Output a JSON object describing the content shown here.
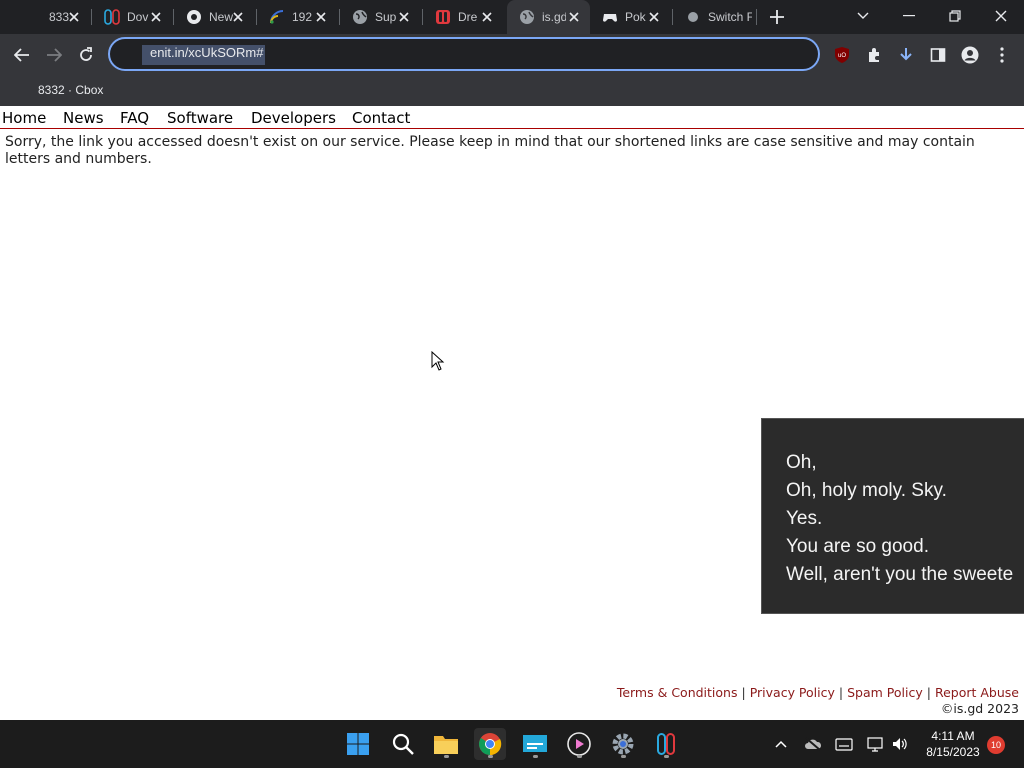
{
  "browser": {
    "tabs": [
      {
        "title": "833",
        "icon": "page-icon"
      },
      {
        "title": "Dov",
        "icon": "switch-logo-icon"
      },
      {
        "title": "New",
        "icon": "chrome-icon"
      },
      {
        "title": "192",
        "icon": "rss-icon"
      },
      {
        "title": "Sup",
        "icon": "globe-icon"
      },
      {
        "title": "Dre",
        "icon": "switch-red-icon"
      },
      {
        "title": "is.gd",
        "icon": "globe-icon"
      },
      {
        "title": "Pok",
        "icon": "gamepad-icon"
      },
      {
        "title": "Switch F",
        "icon": "globe-icon"
      }
    ],
    "active_tab_index": 6,
    "url": "enit.in/xcUkSORm#",
    "bookmarks": [
      {
        "label": "8332 · Cbox"
      }
    ],
    "accent_color": "#7ba7f5"
  },
  "site": {
    "nav": [
      "Home",
      "News",
      "FAQ",
      "Software",
      "Developers",
      "Contact"
    ],
    "message": "Sorry, the link you accessed doesn't exist on our service. Please keep in mind that our shortened links are case sensitive and may contain letters and numbers.",
    "footer_links": [
      "Terms & Conditions",
      "Privacy Policy",
      "Spam Policy",
      "Report Abuse"
    ],
    "footer_separator": "|",
    "copyright": "©is.gd 2023",
    "link_color": "#8b1a1a"
  },
  "captions": {
    "lines": [
      "Oh,",
      "Oh, holy moly. Sky.",
      "Yes.",
      "You are so good.",
      "Well, aren't you the sweete"
    ]
  },
  "taskbar": {
    "apps": [
      "windows-start-icon",
      "search-icon",
      "file-explorer-icon",
      "chrome-icon",
      "screen-app-icon",
      "media-player-icon",
      "settings-icon",
      "switch-app-icon"
    ],
    "time": "4:11 AM",
    "date": "8/15/2023",
    "notifications": "10"
  }
}
